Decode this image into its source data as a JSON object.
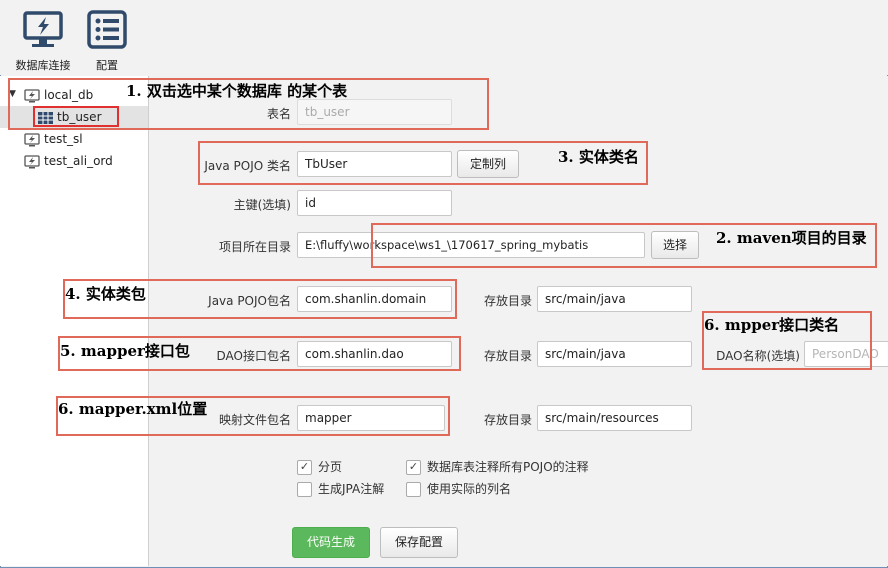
{
  "toolbar": {
    "db_connect_label": "数据库连接",
    "config_label": "配置"
  },
  "tree": {
    "items": [
      {
        "label": "local_db",
        "icon": "database-icon"
      },
      {
        "label": "tb_user",
        "icon": "table-icon"
      },
      {
        "label": "test_sl",
        "icon": "database-icon"
      },
      {
        "label": "test_ali_ord",
        "icon": "database-icon"
      }
    ]
  },
  "form": {
    "table_name": {
      "label": "表名",
      "value": "tb_user"
    },
    "pojo_class": {
      "label": "Java POJO 类名",
      "value": "TbUser",
      "button": "定制列"
    },
    "primary_key": {
      "label": "主键(选填)",
      "value": "id"
    },
    "project_dir": {
      "label": "项目所在目录",
      "value": "E:\\fluffy\\workspace\\ws1_\\170617_spring_mybatis",
      "button": "选择"
    },
    "pojo_package": {
      "label": "Java POJO包名",
      "value": "com.shanlin.domain",
      "dir_label": "存放目录",
      "dir_value": "src/main/java"
    },
    "dao_package": {
      "label": "DAO接口包名",
      "value": "com.shanlin.dao",
      "dir_label": "存放目录",
      "dir_value": "src/main/java",
      "name_label": "DAO名称(选填)",
      "name_placeholder": "PersonDAO"
    },
    "mapper_package": {
      "label": "映射文件包名",
      "value": "mapper",
      "dir_label": "存放目录",
      "dir_value": "src/main/resources"
    },
    "options": [
      {
        "label": "分页",
        "checked": true
      },
      {
        "label": "数据库表注释所有POJO的注释",
        "checked": true
      },
      {
        "label": "生成JPA注解",
        "checked": false
      },
      {
        "label": "使用实际的列名",
        "checked": false
      }
    ],
    "generate_button": "代码生成",
    "save_button": "保存配置"
  },
  "annotations": {
    "a1": "1. 双击选中某个数据库 的某个表",
    "a2": "2. maven项目的目录",
    "a3": "3. 实体类名",
    "a4": "4. 实体类包",
    "a5": "5. mapper接口包",
    "a6a": "6. mpper接口类名",
    "a6b": "6. mapper.xml位置"
  }
}
